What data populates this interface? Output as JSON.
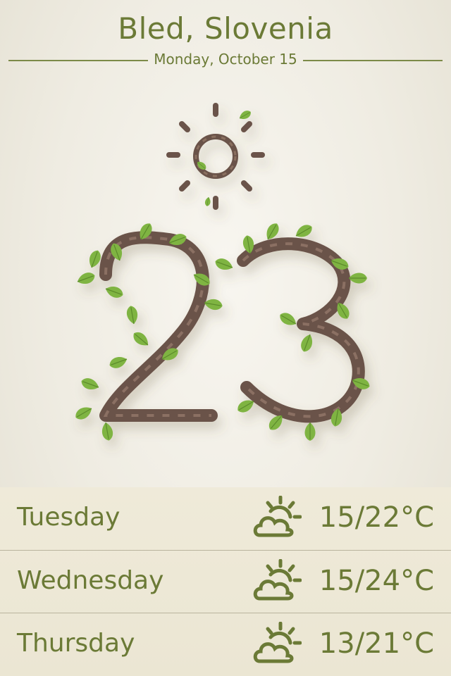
{
  "location": "Bled, Slovenia",
  "date": "Monday, October 15",
  "current": {
    "temperature": "23",
    "condition_icon": "sun-icon"
  },
  "forecast": [
    {
      "day": "Tuesday",
      "icon": "partly-cloudy-icon",
      "temp": "15/22°C"
    },
    {
      "day": "Wednesday",
      "icon": "partly-cloudy-icon",
      "temp": "15/24°C"
    },
    {
      "day": "Thursday",
      "icon": "partly-cloudy-icon",
      "temp": "13/21°C"
    }
  ],
  "colors": {
    "accent": "#6b7a36",
    "leaf": "#7fb443",
    "vine": "#6b5348",
    "background": "#f2efe6"
  }
}
